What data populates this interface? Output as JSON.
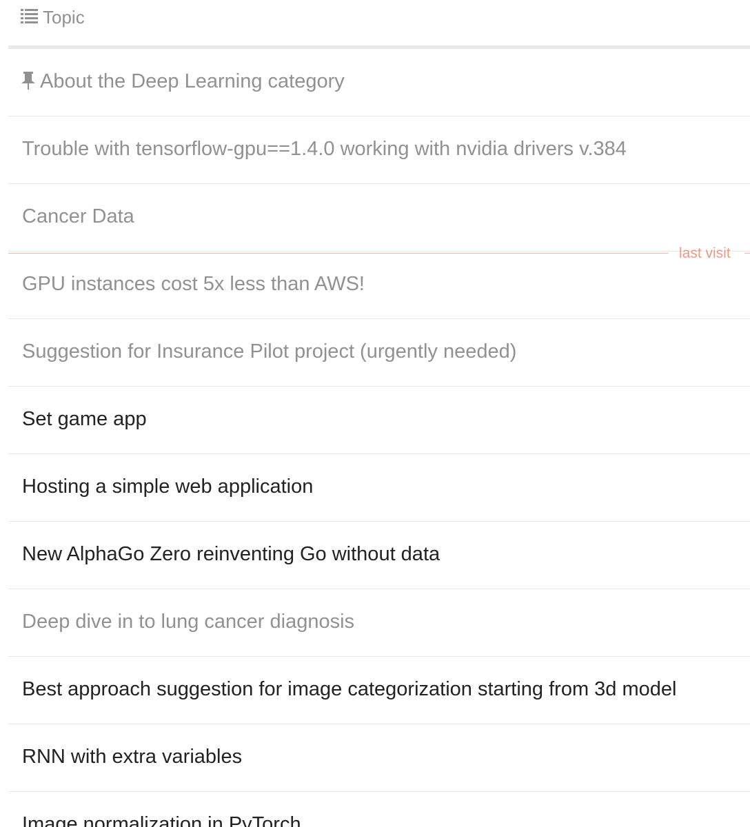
{
  "header": {
    "icon": "list-icon",
    "label": "Topic"
  },
  "last_visit_label": "last visit",
  "colors": {
    "visited_text": "#919191",
    "unread_text": "#222222",
    "last_visit_accent": "#e99a85",
    "divider": "#e9e9e9"
  },
  "topics": [
    {
      "title": "About the Deep Learning category",
      "pinned": true,
      "state": "visited"
    },
    {
      "title": "Trouble with tensorflow-gpu==1.4.0 working with nvidia drivers v.384",
      "pinned": false,
      "state": "visited"
    },
    {
      "title": "Cancer Data",
      "pinned": false,
      "state": "visited"
    },
    {
      "title": "GPU instances cost 5x less than AWS!",
      "pinned": false,
      "state": "visited"
    },
    {
      "title": "Suggestion for Insurance Pilot project (urgently needed)",
      "pinned": false,
      "state": "visited"
    },
    {
      "title": "Set game app",
      "pinned": false,
      "state": "unread"
    },
    {
      "title": "Hosting a simple web application",
      "pinned": false,
      "state": "unread"
    },
    {
      "title": "New AlphaGo Zero reinventing Go without data",
      "pinned": false,
      "state": "unread"
    },
    {
      "title": "Deep dive in to lung cancer diagnosis",
      "pinned": false,
      "state": "visited"
    },
    {
      "title": "Best approach suggestion for image categorization starting from 3d model",
      "pinned": false,
      "state": "unread"
    },
    {
      "title": "RNN with extra variables",
      "pinned": false,
      "state": "unread"
    },
    {
      "title": "Image normalization in PyTorch",
      "pinned": false,
      "state": "unread"
    }
  ]
}
